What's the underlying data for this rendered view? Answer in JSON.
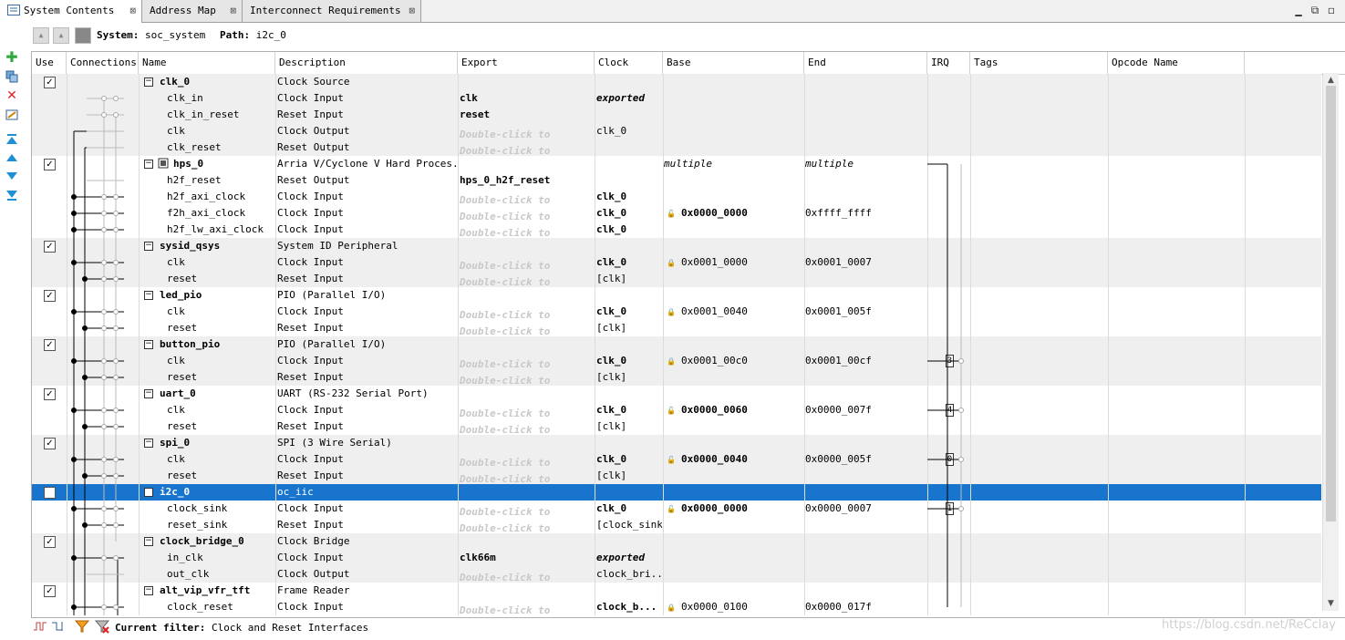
{
  "tabs": [
    {
      "label": "System Contents",
      "active": true
    },
    {
      "label": "Address Map",
      "active": false
    },
    {
      "label": "Interconnect Requirements",
      "active": false
    }
  ],
  "tab_close_glyph": "⊠",
  "window_buttons": [
    "▁",
    "⧉",
    "◻"
  ],
  "system_bar": {
    "system_label": "System:",
    "system_value": "soc_system",
    "path_label": "Path:",
    "path_value": "i2c_0"
  },
  "columns": [
    "Use",
    "Connections",
    "Name",
    "Description",
    "Export",
    "Clock",
    "Base",
    "End",
    "IRQ",
    "Tags",
    "Opcode Name"
  ],
  "rows": [
    {
      "type": "module",
      "name": "clk_0",
      "desc": "Clock Source",
      "checked": true,
      "bg": "grey"
    },
    {
      "type": "iface",
      "name": "clk_in",
      "desc": "Clock Input",
      "export": "clk",
      "export_bold": true,
      "clock": "exported",
      "clock_italic": true,
      "bg": "grey"
    },
    {
      "type": "iface",
      "name": "clk_in_reset",
      "desc": "Reset Input",
      "export": "reset",
      "export_bold": true,
      "bg": "grey"
    },
    {
      "type": "iface",
      "name": "clk",
      "desc": "Clock Output",
      "export": "Double-click to",
      "export_dim": true,
      "clock": "clk_0",
      "bg": "grey"
    },
    {
      "type": "iface",
      "name": "clk_reset",
      "desc": "Reset Output",
      "export": "Double-click to",
      "export_dim": true,
      "bg": "grey"
    },
    {
      "type": "module",
      "name": "hps_0",
      "desc": "Arria V/Cyclone V Hard Proces...",
      "checked": true,
      "base": "multiple",
      "base_italic": true,
      "end": "multiple",
      "end_italic": true,
      "bg": "white",
      "chip": true
    },
    {
      "type": "iface",
      "name": "h2f_reset",
      "desc": "Reset Output",
      "export": "hps_0_h2f_reset",
      "export_bold": true,
      "bg": "white"
    },
    {
      "type": "iface",
      "name": "h2f_axi_clock",
      "desc": "Clock Input",
      "export": "Double-click to",
      "export_dim": true,
      "clock": "clk_0",
      "clock_bold": true,
      "bg": "white"
    },
    {
      "type": "iface",
      "name": "f2h_axi_clock",
      "desc": "Clock Input",
      "export": "Double-click to",
      "export_dim": true,
      "clock": "clk_0",
      "clock_bold": true,
      "base": "0x0000_0000",
      "base_bold": true,
      "lock": "open",
      "end": "0xffff_ffff",
      "bg": "white"
    },
    {
      "type": "iface",
      "name": "h2f_lw_axi_clock",
      "desc": "Clock Input",
      "export": "Double-click to",
      "export_dim": true,
      "clock": "clk_0",
      "clock_bold": true,
      "bg": "white"
    },
    {
      "type": "module",
      "name": "sysid_qsys",
      "desc": "System ID Peripheral",
      "checked": true,
      "bg": "grey"
    },
    {
      "type": "iface",
      "name": "clk",
      "desc": "Clock Input",
      "export": "Double-click to",
      "export_dim": true,
      "clock": "clk_0",
      "clock_bold": true,
      "base": "0x0001_0000",
      "lock": "closed",
      "end": "0x0001_0007",
      "bg": "grey"
    },
    {
      "type": "iface",
      "name": "reset",
      "desc": "Reset Input",
      "export": "Double-click to",
      "export_dim": true,
      "clock": "[clk]",
      "bg": "grey"
    },
    {
      "type": "module",
      "name": "led_pio",
      "desc": "PIO (Parallel I/O)",
      "checked": true,
      "bg": "white"
    },
    {
      "type": "iface",
      "name": "clk",
      "desc": "Clock Input",
      "export": "Double-click to",
      "export_dim": true,
      "clock": "clk_0",
      "clock_bold": true,
      "base": "0x0001_0040",
      "lock": "closed",
      "end": "0x0001_005f",
      "bg": "white"
    },
    {
      "type": "iface",
      "name": "reset",
      "desc": "Reset Input",
      "export": "Double-click to",
      "export_dim": true,
      "clock": "[clk]",
      "bg": "white"
    },
    {
      "type": "module",
      "name": "button_pio",
      "desc": "PIO (Parallel I/O)",
      "checked": true,
      "bg": "grey"
    },
    {
      "type": "iface",
      "name": "clk",
      "desc": "Clock Input",
      "export": "Double-click to",
      "export_dim": true,
      "clock": "clk_0",
      "clock_bold": true,
      "base": "0x0001_00c0",
      "lock": "closed",
      "end": "0x0001_00cf",
      "irq": "3",
      "bg": "grey"
    },
    {
      "type": "iface",
      "name": "reset",
      "desc": "Reset Input",
      "export": "Double-click to",
      "export_dim": true,
      "clock": "[clk]",
      "bg": "grey"
    },
    {
      "type": "module",
      "name": "uart_0",
      "desc": "UART (RS-232 Serial Port)",
      "checked": true,
      "bg": "white"
    },
    {
      "type": "iface",
      "name": "clk",
      "desc": "Clock Input",
      "export": "Double-click to",
      "export_dim": true,
      "clock": "clk_0",
      "clock_bold": true,
      "base": "0x0000_0060",
      "base_bold": true,
      "lock": "open",
      "end": "0x0000_007f",
      "irq": "4",
      "bg": "white"
    },
    {
      "type": "iface",
      "name": "reset",
      "desc": "Reset Input",
      "export": "Double-click to",
      "export_dim": true,
      "clock": "[clk]",
      "bg": "white"
    },
    {
      "type": "module",
      "name": "spi_0",
      "desc": "SPI (3 Wire Serial)",
      "checked": true,
      "bg": "grey"
    },
    {
      "type": "iface",
      "name": "clk",
      "desc": "Clock Input",
      "export": "Double-click to",
      "export_dim": true,
      "clock": "clk_0",
      "clock_bold": true,
      "base": "0x0000_0040",
      "base_bold": true,
      "lock": "open",
      "end": "0x0000_005f",
      "irq": "0",
      "bg": "grey"
    },
    {
      "type": "iface",
      "name": "reset",
      "desc": "Reset Input",
      "export": "Double-click to",
      "export_dim": true,
      "clock": "[clk]",
      "bg": "grey"
    },
    {
      "type": "module",
      "name": "i2c_0",
      "desc": "oc_iic",
      "checked": true,
      "bg": "selected"
    },
    {
      "type": "iface",
      "name": "clock_sink",
      "desc": "Clock Input",
      "export": "Double-click to",
      "export_dim": true,
      "clock": "clk_0",
      "clock_bold": true,
      "base": "0x0000_0000",
      "base_bold": true,
      "lock": "open",
      "end": "0x0000_0007",
      "irq": "1",
      "bg": "white"
    },
    {
      "type": "iface",
      "name": "reset_sink",
      "desc": "Reset Input",
      "export": "Double-click to",
      "export_dim": true,
      "clock": "[clock_sink]",
      "bg": "white"
    },
    {
      "type": "module",
      "name": "clock_bridge_0",
      "desc": "Clock Bridge",
      "checked": true,
      "bg": "grey"
    },
    {
      "type": "iface",
      "name": "in_clk",
      "desc": "Clock Input",
      "export": "clk66m",
      "export_bold": true,
      "clock": "exported",
      "clock_italic": true,
      "bg": "grey"
    },
    {
      "type": "iface",
      "name": "out_clk",
      "desc": "Clock Output",
      "export": "Double-click to",
      "export_dim": true,
      "clock": "clock_bri...",
      "bg": "grey"
    },
    {
      "type": "module",
      "name": "alt_vip_vfr_tft",
      "desc": "Frame Reader",
      "checked": true,
      "bg": "white"
    },
    {
      "type": "iface",
      "name": "clock_reset",
      "desc": "Clock Input",
      "export": "Double-click to",
      "export_dim": true,
      "clock": "clock_b...",
      "clock_bold": true,
      "base": "0x0000_0100",
      "lock": "closed",
      "end": "0x0000_017f",
      "bg": "white"
    }
  ],
  "filter_bar": {
    "label": "Current filter:",
    "value": "Clock and Reset Interfaces"
  },
  "watermark": "https://blog.csdn.net/ReCclay",
  "colors": {
    "selected": "#1874cd",
    "row_grey": "#efefef",
    "add_green": "#2eaa3a",
    "remove_red": "#e02020",
    "arrow_blue": "#1f8fd6"
  }
}
